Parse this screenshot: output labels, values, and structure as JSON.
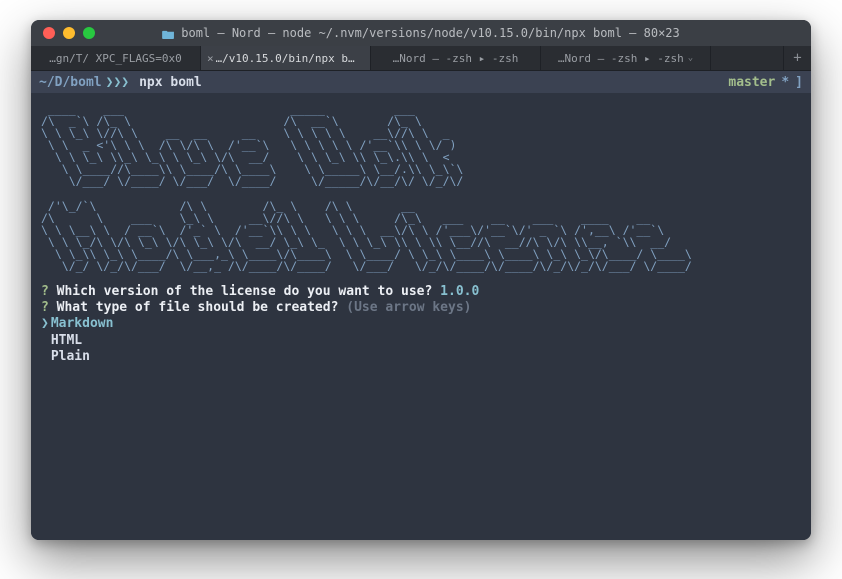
{
  "window": {
    "title": "boml — Nord — node ~/.nvm/versions/node/v10.15.0/bin/npx boml — 80×23"
  },
  "tabs": [
    {
      "label": "…gn/T/ XPC_FLAGS=0x0",
      "active": false,
      "closable": false
    },
    {
      "label": "…/v10.15.0/bin/npx boml",
      "active": true,
      "closable": true
    },
    {
      "label": "…Nord — -zsh ▸ -zsh",
      "active": false,
      "closable": false
    },
    {
      "label": "…Nord — -zsh ▸ -zsh",
      "active": false,
      "closable": false
    }
  ],
  "tab_plus": "+",
  "prompt": {
    "path": "~/D/boml",
    "chev": "❯❯❯",
    "command": "npx boml",
    "branch": "master",
    "star": "*",
    "rbracket": "]"
  },
  "ascii_art": " ____    ___                        _____          ___\n/\\  _`\\ /\\_ \\                      /\\  __`\\       /\\_ \\\n\\ \\ \\_\\ \\//\\ \\    __  __     __    \\ \\ \\ \\ \\    __\\//\\ \\  _\n \\ \\  _ <'\\ \\ \\  /\\ \\/\\ \\  /'__`\\   \\ \\ \\ \\ \\ /'__`\\\\ \\ \\/ )\n  \\ \\ \\_\\ \\\\_\\ \\_\\ \\ \\_\\ \\/\\  __/    \\ \\ \\_\\ \\\\ \\_\\.\\\\ \\  <\n   \\ \\____//\\____\\\\ \\____/\\ \\____\\    \\ \\_____\\ \\__/.\\\\ \\_\\`\\\n    \\/___/ \\/____/ \\/___/  \\/____/     \\/_____/\\/__/\\/ \\/_/\\/\n\n /'\\_/`\\            /\\ \\        /\\_ \\    /\\ \\       __\n/\\      \\    ___    \\_\\ \\     __\\//\\ \\   \\ \\ \\     /\\_\\   ___    __    ___    ____    __\n\\ \\ \\__\\ \\  / __`\\  /'_` \\  /'__`\\\\ \\ \\   \\ \\ \\  __\\/\\ \\ /'___\\/'__`\\/' _ `\\ /',__\\ /'__`\\\n \\ \\ \\_/\\ \\/\\ \\_\\ \\/\\ \\_\\ \\/\\  __/ \\_\\ \\_  \\ \\ \\_\\ \\\\ \\ \\\\ \\__//\\  __//\\ \\/\\ \\\\__, `\\\\  __/\n  \\ \\_\\\\ \\_\\ \\____/\\ \\___,_\\ \\____\\/\\____\\  \\ \\____/ \\ \\_\\ \\____\\ \\____\\ \\_\\ \\_\\/\\____/ \\____\\\n   \\/_/ \\/_/\\/___/  \\/__,_ /\\/____/\\/____/   \\/___/   \\/_/\\/____/\\/____/\\/_/\\/_/\\/___/ \\/____/",
  "questions": [
    {
      "prompt": "Which version of the license do you want to use?",
      "answer": "1.0.0"
    },
    {
      "prompt": "What type of file should be created?",
      "hint": "(Use arrow keys)"
    }
  ],
  "options": [
    {
      "label": "Markdown",
      "selected": true
    },
    {
      "label": "HTML",
      "selected": false
    },
    {
      "label": "Plain",
      "selected": false
    }
  ],
  "glyphs": {
    "qmark": "?",
    "caret": "❯"
  }
}
